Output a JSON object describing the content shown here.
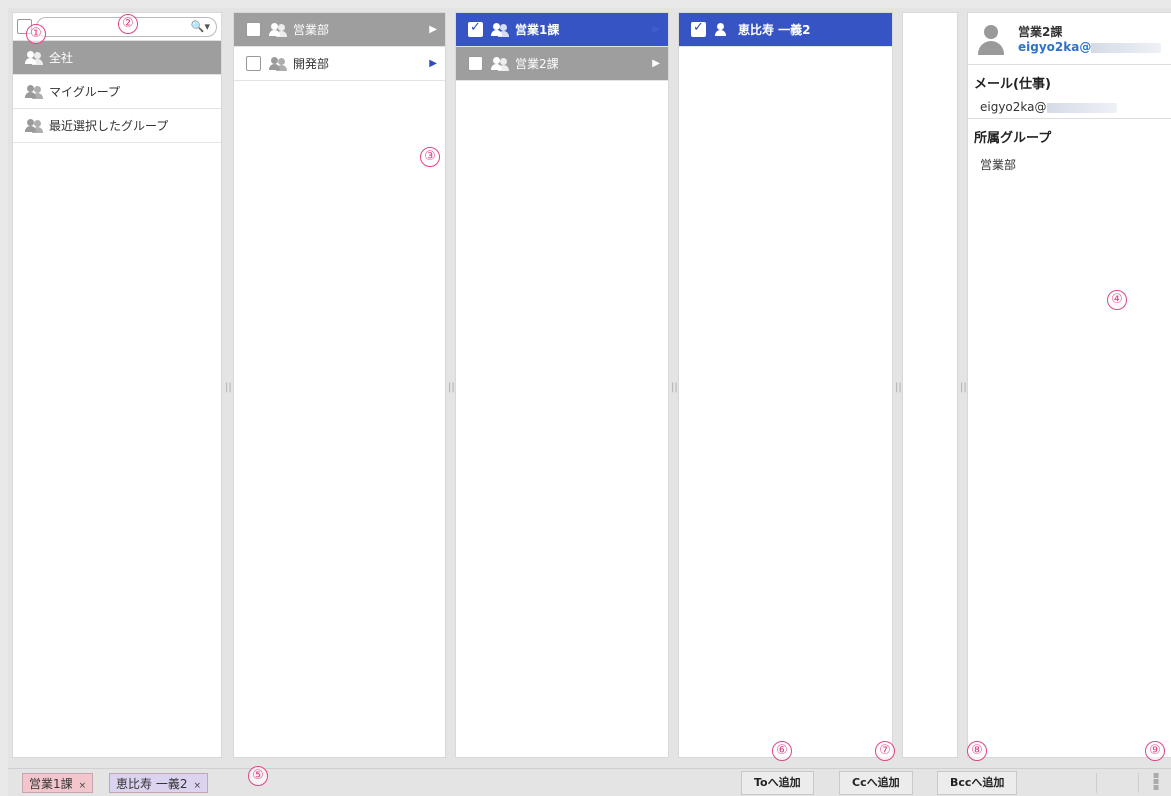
{
  "colors": {
    "accent_blue": "#3654c4",
    "selected_gray": "#9e9e9e",
    "callout_pink": "#e0458a",
    "chip_pink": "#f3c6cd",
    "chip_lavender": "#dcd3f0",
    "link_blue": "#2f73c8"
  },
  "col1": {
    "search_icon": "🔍▾",
    "items": [
      {
        "label": "全社",
        "icon": "group-icon",
        "state": "selected"
      },
      {
        "label": "マイグループ",
        "icon": "group-icon",
        "state": "plain"
      },
      {
        "label": "最近選択したグループ",
        "icon": "group-icon",
        "state": "plain"
      }
    ]
  },
  "col2": {
    "items": [
      {
        "label": "営業部",
        "checked": false,
        "state": "selected",
        "arrow": "▶"
      },
      {
        "label": "開発部",
        "checked": false,
        "state": "plain",
        "arrow": "▶"
      }
    ]
  },
  "col3": {
    "items": [
      {
        "label": "営業1課",
        "checked": true,
        "state": "active",
        "arrow": "▶"
      },
      {
        "label": "営業2課",
        "checked": false,
        "state": "selected",
        "arrow": "▶"
      }
    ]
  },
  "col4": {
    "items": [
      {
        "label": "恵比寿 一義2",
        "checked": true,
        "state": "active"
      }
    ]
  },
  "detail": {
    "name": "営業2課",
    "email": "eigyo2ka@",
    "mail_title": "メール(仕事)",
    "mail_value": "eigyo2ka@",
    "group_title": "所属グループ",
    "group_value": "営業部"
  },
  "bottom": {
    "chips": [
      {
        "label": "営業1課",
        "x": "×"
      },
      {
        "label": "恵比寿 一義2",
        "x": "×"
      }
    ],
    "to_button": "Toへ追加",
    "cc_button": "Ccへ追加",
    "bcc_button": "Bccへ追加"
  },
  "callouts": [
    "①",
    "②",
    "③",
    "④",
    "⑤",
    "⑥",
    "⑦",
    "⑧",
    "⑨"
  ],
  "splitter_glyph": "||"
}
